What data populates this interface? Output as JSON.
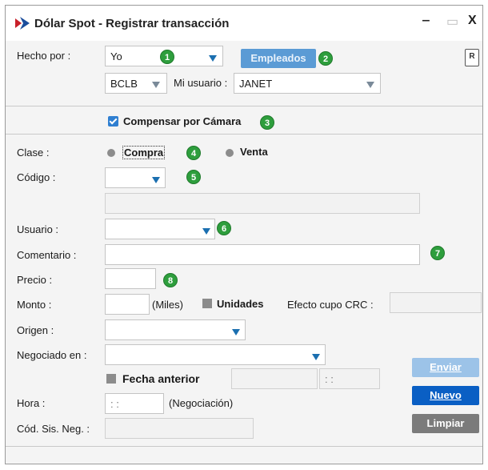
{
  "window": {
    "title": "Dólar Spot - Registrar transacción",
    "controls": {
      "minimize": "‒",
      "maximize": "▭",
      "close": "X"
    }
  },
  "report_icon": "R",
  "hecho_por": {
    "label": "Hecho por :",
    "value": "Yo",
    "employees_button": "Empleados",
    "badge1": "1",
    "badge2": "2"
  },
  "bank": {
    "value": "BCLB"
  },
  "mi_usuario": {
    "label": "Mi usuario :",
    "value": "JANET"
  },
  "compensar": {
    "label": "Compensar por Cámara",
    "checked": true,
    "badge": "3"
  },
  "clase": {
    "label": "Clase :",
    "compra": "Compra",
    "venta": "Venta",
    "badge": "4"
  },
  "codigo": {
    "label": "Código :",
    "value": "",
    "description": "",
    "badge": "5"
  },
  "usuario": {
    "label": "Usuario :",
    "value": "",
    "badge": "6"
  },
  "comentario": {
    "label": "Comentario :",
    "value": "",
    "badge": "7"
  },
  "precio": {
    "label": "Precio :",
    "value": "",
    "badge": "8"
  },
  "monto": {
    "label": "Monto :",
    "value": "",
    "units_hint": "(Miles)",
    "unidades": "Unidades",
    "efecto_label": "Efecto cupo CRC :",
    "efecto_value": ""
  },
  "origen": {
    "label": "Origen :",
    "value": ""
  },
  "negociado": {
    "label": "Negociado en :",
    "value": ""
  },
  "fecha_anterior": {
    "label": "Fecha anterior",
    "date": "",
    "time": ": :"
  },
  "hora": {
    "label": "Hora :",
    "value": ": :",
    "hint": "(Negociación)"
  },
  "cod_sis": {
    "label": "Cód. Sis. Neg. :",
    "value": ""
  },
  "buttons": {
    "enviar": "Enviar",
    "nuevo": "Nuevo",
    "limpiar": "Limpiar"
  },
  "colors": {
    "accent": "#0a5fc4",
    "badge": "#2e9e3d",
    "employees": "#5b9bd5"
  }
}
